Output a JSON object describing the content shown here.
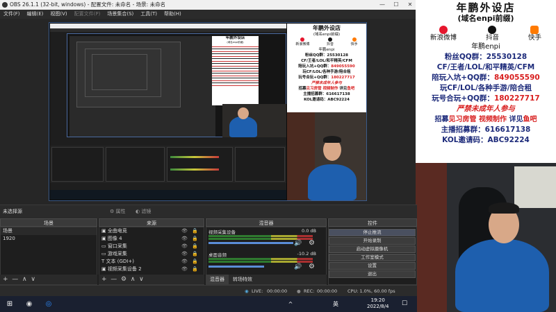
{
  "window": {
    "title": "OBS 26.1.1 (32-bit, windows) - 配置文件: 未命名 - 场景: 未命名",
    "min": "—",
    "max": "☐",
    "close": "✕"
  },
  "menu": [
    "文件(F)",
    "编辑(E)",
    "视图(V)",
    "配置文件(P)",
    "场景集合(S)",
    "工具(T)",
    "帮助(H)"
  ],
  "scene_toolbar": {
    "no_source": "未选择源",
    "properties": "属性",
    "filters": "滤镜"
  },
  "docks": {
    "scenes": {
      "title": "场景",
      "items": [
        "场景",
        "1920"
      ],
      "footer": [
        "+",
        "—",
        "∧",
        "∨"
      ]
    },
    "sources": {
      "title": "来源",
      "items": [
        {
          "icon": "▣",
          "label": "全曲电竞"
        },
        {
          "icon": "▣",
          "label": "图像 4"
        },
        {
          "icon": "▭",
          "label": "窗口采集"
        },
        {
          "icon": "▭",
          "label": "游戏采集"
        },
        {
          "icon": "T",
          "label": "文本 (GDI+)"
        },
        {
          "icon": "▣",
          "label": "视频采集设备 2"
        }
      ],
      "eye": "👁",
      "lock": "🔒",
      "footer": [
        "+",
        "—",
        "⚙",
        "∧",
        "∨"
      ]
    },
    "mixer": {
      "title": "混音器",
      "channel1_name": "视频采集设备",
      "channel1_db": "0.0 dB",
      "channel2_name": "桌面音频",
      "channel2_db": "-10.2 dB",
      "tabs": [
        "混音器",
        "转场特效"
      ],
      "speaker": "🔊",
      "gear": "⚙"
    },
    "controls": {
      "title": "控件",
      "buttons": [
        "停止推流",
        "开始录制",
        "启动虚拟摄像机",
        "工作室模式",
        "设置",
        "退出"
      ]
    }
  },
  "status": {
    "live_label": "LIVE:",
    "live_time": "00:00:00",
    "rec_label": "REC:",
    "rec_time": "00:00:00",
    "cpu": "CPU: 1.0%, 60.00 fps"
  },
  "taskbar": {
    "time": "19:20",
    "date": "2022/8/4",
    "ime": "英",
    "notify": "☐"
  },
  "poster": {
    "title": "年鹏外设店",
    "subtitle": "(域名enpi前缀)",
    "brands": [
      {
        "name": "新浪微博",
        "color": "#e6162d"
      },
      {
        "name": "抖音",
        "color": "#111111"
      },
      {
        "name": "快手",
        "color": "#ff7a00"
      }
    ],
    "handle": "年鹏enpi",
    "fans_line": "粉丝QQ群：25530128",
    "games_line": "CF/王者/LOL/和平精英/CFM",
    "group1_prefix": "陪玩入坑+QQ群：",
    "group1_num": "849055590",
    "group2_line": "玩CF/LOL/各种手游/陪合租",
    "group3_prefix": "玩号合玩+QQ群：",
    "group3_num": "180227717",
    "warning": "严禁未成年人参与",
    "recruit_prefix": "招募",
    "recruit_red": "见习房管 视频制作",
    "recruit_mid": " 详见",
    "recruit_red2": "鱼吧",
    "anchor_line": "主播招募群：616617138",
    "kol_line": "KOL邀请码：ABC92224"
  },
  "nested_poster_short": {
    "title": "年鹏外设店",
    "subtitle": "(域名enpi前缀)"
  }
}
